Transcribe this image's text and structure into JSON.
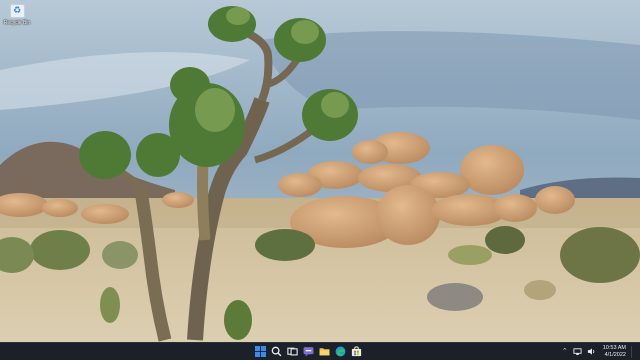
{
  "desktop": {
    "wallpaper": "joshua-tree-desert-landscape",
    "icons": [
      {
        "label": "Recycle Bin",
        "icon": "recycle-bin-icon"
      }
    ]
  },
  "taskbar": {
    "pinned_apps": [
      {
        "name": "start",
        "icon": "windows-start-icon"
      },
      {
        "name": "search",
        "icon": "search-icon"
      },
      {
        "name": "task-view",
        "icon": "task-view-icon"
      },
      {
        "name": "chat",
        "icon": "chat-icon"
      },
      {
        "name": "file-explorer",
        "icon": "folder-icon"
      },
      {
        "name": "edge",
        "icon": "edge-browser-icon"
      },
      {
        "name": "store",
        "icon": "store-icon"
      }
    ],
    "tray": {
      "overflow_icon": "chevron-up-icon",
      "icons": [
        "network-icon",
        "volume-icon"
      ],
      "time": "10:53 AM",
      "date": "4/1/2022"
    }
  },
  "colors": {
    "taskbar_bg": "#1b2029",
    "accent": "#3b8be8"
  }
}
